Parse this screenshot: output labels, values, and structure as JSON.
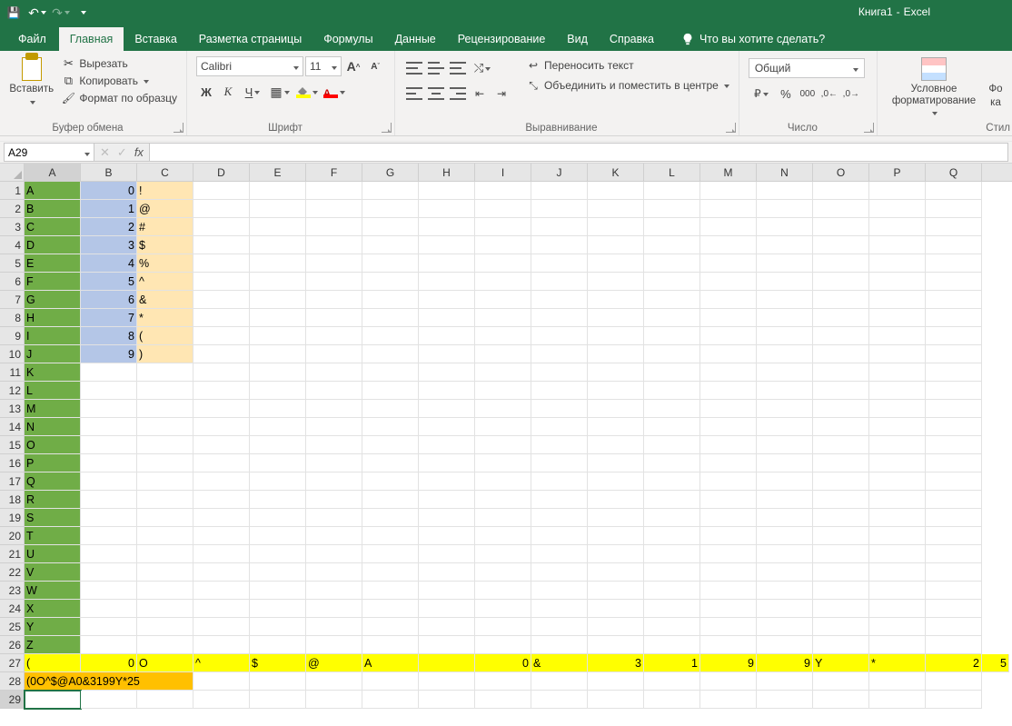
{
  "title": {
    "workbook": "Книга1",
    "app": "Excel"
  },
  "tabs": {
    "file": "Файл",
    "list": [
      "Главная",
      "Вставка",
      "Разметка страницы",
      "Формулы",
      "Данные",
      "Рецензирование",
      "Вид",
      "Справка"
    ],
    "activeIndex": 0,
    "tell_me": "Что вы хотите сделать?"
  },
  "ribbon": {
    "clipboard": {
      "paste": "Вставить",
      "cut": "Вырезать",
      "copy": "Копировать",
      "format_painter": "Формат по образцу",
      "group": "Буфер обмена"
    },
    "font": {
      "name": "Calibri",
      "size": "11",
      "group": "Шрифт"
    },
    "alignment": {
      "wrap": "Переносить текст",
      "merge": "Объединить и поместить в центре",
      "group": "Выравнивание"
    },
    "number": {
      "format": "Общий",
      "group": "Число"
    },
    "styles": {
      "cond": "Условное форматирование",
      "fmt": "Фо",
      "as": "ка",
      "group": "Стил"
    }
  },
  "namebox": "A29",
  "columns": [
    "A",
    "B",
    "C",
    "D",
    "E",
    "F",
    "G",
    "H",
    "I",
    "J",
    "K",
    "L",
    "M",
    "N",
    "O",
    "P",
    "Q"
  ],
  "cells": {
    "colA": [
      "A",
      "B",
      "C",
      "D",
      "E",
      "F",
      "G",
      "H",
      "I",
      "J",
      "K",
      "L",
      "M",
      "N",
      "O",
      "P",
      "Q",
      "R",
      "S",
      "T",
      "U",
      "V",
      "W",
      "X",
      "Y",
      "Z"
    ],
    "colB": [
      "0",
      "1",
      "2",
      "3",
      "4",
      "5",
      "6",
      "7",
      "8",
      "9"
    ],
    "colC": [
      "!",
      "@",
      "#",
      "$",
      "%",
      "^",
      "&",
      "*",
      "(",
      ")"
    ],
    "row27": {
      "A": "(",
      "B": "0",
      "C": "O",
      "D": "^",
      "E": "$",
      "F": "@",
      "G": "A",
      "H": "",
      "I": "0",
      "J": "&",
      "K": "3",
      "L": "1",
      "M": "9",
      "N": "9",
      "O": "Y",
      "P": "*",
      "Q": "2",
      "R": "5"
    },
    "row28_text": "(0O^$@A0&3199Y*25"
  }
}
